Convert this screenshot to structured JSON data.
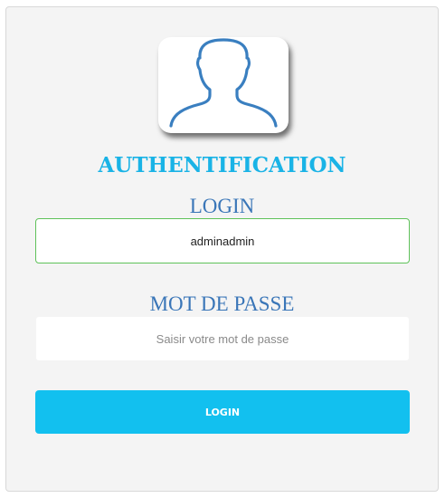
{
  "header": {
    "avatar_icon": "user-silhouette-icon",
    "title": "AUTHENTIFICATION"
  },
  "login_field": {
    "label": "LOGIN",
    "value": "adminadmin"
  },
  "password_field": {
    "label": "MOT DE PASSE",
    "value": "",
    "placeholder": "Saisir votre mot de passe"
  },
  "submit": {
    "label": "LOGIN"
  },
  "colors": {
    "title": "#1ab3e6",
    "labels": "#3a76b8",
    "button": "#12c0ef",
    "login_border": "#5fc25a",
    "panel": "#f4f4f4"
  }
}
